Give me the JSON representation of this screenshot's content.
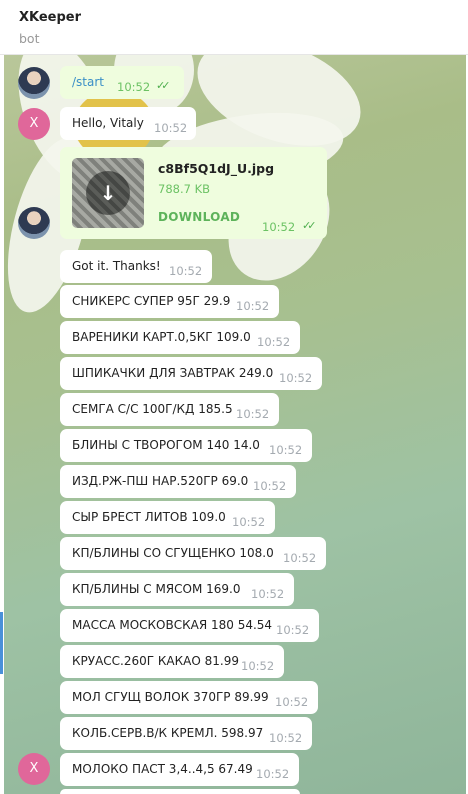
{
  "header": {
    "title": "XKeeper",
    "status": "bot"
  },
  "messages": [
    {
      "text": "/start",
      "time": "10:52"
    },
    {
      "text": "Hello, Vitaly",
      "time": "10:52"
    },
    {
      "file_name": "c8Bf5Q1dJ_U.jpg",
      "file_size": "788.7 KB",
      "download_label": "DOWNLOAD",
      "time": "10:52"
    },
    {
      "text": "Got it. Thanks!",
      "time": "10:52"
    },
    {
      "text": "СНИКЕРС СУПЕР 95Г 29.9",
      "time": "10:52"
    },
    {
      "text": "ВАРЕНИКИ КАРТ.0,5КГ 109.0",
      "time": "10:52"
    },
    {
      "text": "ШПИКАЧКИ ДЛЯ ЗАВТРАК 249.0",
      "time": "10:52"
    },
    {
      "text": "СЕМГА С/С 100Г/КД 185.5",
      "time": "10:52"
    },
    {
      "text": "БЛИНЫ С ТВОРОГОМ 140 14.0",
      "time": "10:52"
    },
    {
      "text": "ИЗД.РЖ-ПШ НАР.520ГР 69.0",
      "time": "10:52"
    },
    {
      "text": "СЫР БРЕСТ ЛИТОВ 109.0",
      "time": "10:52"
    },
    {
      "text": "КП/БЛИНЫ СО СГУЩЕНКО 108.0",
      "time": "10:52"
    },
    {
      "text": "КП/БЛИНЫ С МЯСОМ 169.0",
      "time": "10:52"
    },
    {
      "text": "МАССА МОСКОВСКАЯ 180 54.54",
      "time": "10:52"
    },
    {
      "text": "КРУАСС.260Г КАКАО 81.99",
      "time": "10:52"
    },
    {
      "text": "МОЛ СГУЩ ВОЛОК 370ГР 89.99",
      "time": "10:52"
    },
    {
      "text": "КОЛБ.СЕРВ.В/К КРЕМЛ. 598.97",
      "time": "10:52"
    },
    {
      "text": "МОЛОКО ПАСТ 3,4..4,5 67.49",
      "time": "10:52"
    }
  ],
  "avatar_letter": "X",
  "icons": {
    "read_receipt": "double-check-icon",
    "download": "download-arrow-icon"
  },
  "colors": {
    "outgoing_bubble": "#effdde",
    "incoming_bubble": "#ffffff",
    "accent_green": "#5db35a",
    "bot_avatar": "#e0679a"
  }
}
